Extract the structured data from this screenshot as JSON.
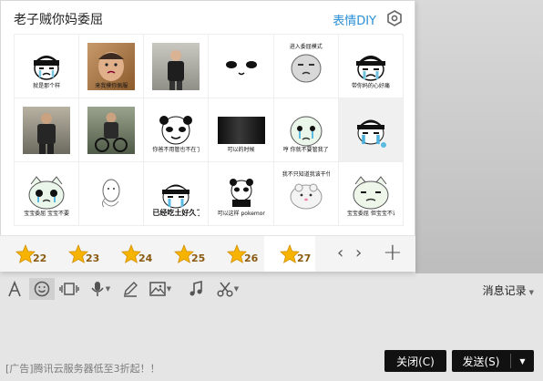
{
  "panel": {
    "title": "老子贼你妈委屈",
    "diy_label": "表情DIY",
    "stickers": [
      {
        "kind": "cartoon",
        "caption": "就是那个样"
      },
      {
        "kind": "photo",
        "caption": "来我摸你佩服"
      },
      {
        "kind": "photo",
        "caption": ""
      },
      {
        "kind": "cartoon",
        "caption": ""
      },
      {
        "kind": "cartoon",
        "caption": "进入委屈模式",
        "caption_pos": "top"
      },
      {
        "kind": "cartoon",
        "caption": "带你妈的心好痛"
      },
      {
        "kind": "photo",
        "caption": ""
      },
      {
        "kind": "photo",
        "caption": ""
      },
      {
        "kind": "cartoon",
        "caption": "你爸不用管也不在了我家的事情吧"
      },
      {
        "kind": "photo",
        "caption": "可以的时候"
      },
      {
        "kind": "cartoon",
        "caption": "哼 你就不要管我了"
      },
      {
        "kind": "cartoon",
        "caption": ""
      },
      {
        "kind": "cartoon",
        "caption": "宝宝委屈 宝宝不要"
      },
      {
        "kind": "cartoon",
        "caption": ""
      },
      {
        "kind": "cartoon",
        "caption": "已经吃土好久了",
        "big": true
      },
      {
        "kind": "cartoon",
        "caption": "可以这样 pokemongo"
      },
      {
        "kind": "cartoon",
        "caption": "我不只知道我该干什么好",
        "caption_pos": "top"
      },
      {
        "kind": "cartoon",
        "caption": "宝宝委屈 但宝宝不说"
      }
    ]
  },
  "tabs": [
    {
      "num": "22"
    },
    {
      "num": "23"
    },
    {
      "num": "24"
    },
    {
      "num": "25"
    },
    {
      "num": "26"
    },
    {
      "num": "27",
      "active": true
    }
  ],
  "nav": {
    "prev": "‹",
    "next": "›",
    "add": "+"
  },
  "toolbar": {
    "tools": [
      "font-icon",
      "emoji-icon",
      "screenshot-icon",
      "voice-icon",
      "pen-icon",
      "image-icon",
      "music-icon",
      "scissors-icon"
    ],
    "history_label": "消息记录"
  },
  "bottom": {
    "ad_text": "[广告]腾讯云服务器低至3折起！！",
    "close_label": "关闭(C)",
    "send_label": "发送(S)"
  },
  "colors": {
    "accent": "#2a8fd6",
    "star": "#f6b400",
    "button": "#111111"
  }
}
